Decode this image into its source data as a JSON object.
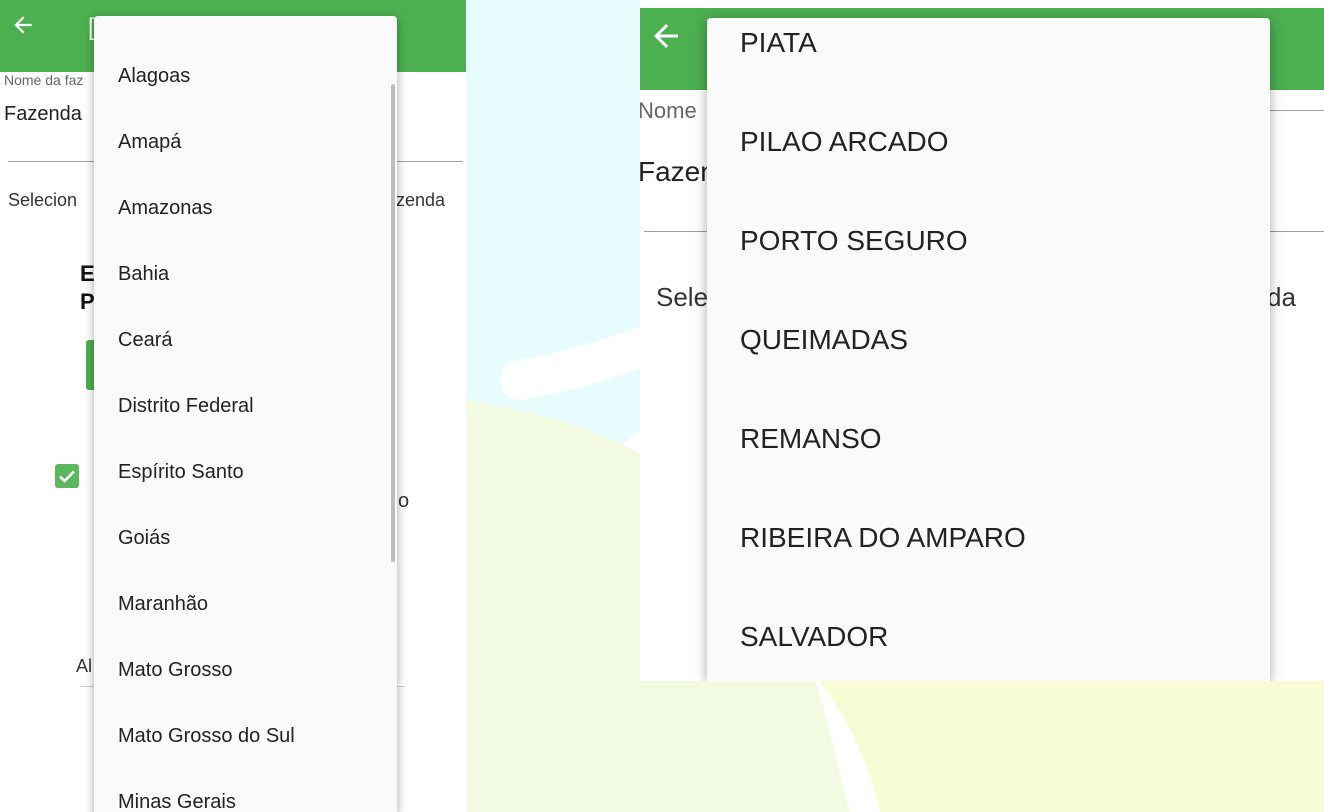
{
  "colors": {
    "appbar": "#4caf50",
    "checkbox": "#5cb85c",
    "menu_background": "#fafafa",
    "background_art": [
      "#e6fcfd",
      "#f2fbe2",
      "#f8fcd5"
    ]
  },
  "left": {
    "appbar": {
      "back_icon": "arrow-left-icon",
      "title_partial": "["
    },
    "field": {
      "label": "Nome da faz",
      "value": "Fazenda"
    },
    "select_text": {
      "left": "Selecion",
      "right": "azenda"
    },
    "heading_partial": {
      "line1": "E",
      "line2": "P"
    },
    "check_text_tail": "o",
    "lower_partial_text": "Al",
    "state_menu": {
      "items": [
        "Alagoas",
        "Amapá",
        "Amazonas",
        "Bahia",
        "Ceará",
        "Distrito Federal",
        "Espírito Santo",
        "Goiás",
        "Maranhão",
        "Mato Grosso",
        "Mato Grosso do Sul",
        "Minas Gerais"
      ]
    }
  },
  "right": {
    "appbar": {
      "back_icon": "arrow-left-icon"
    },
    "field": {
      "label": "Nome",
      "value": "Fazen"
    },
    "select_text": {
      "left": "Sele",
      "right": "da"
    },
    "city_menu": {
      "items": [
        "PIATA",
        "PILAO ARCADO",
        "PORTO SEGURO",
        "QUEIMADAS",
        "REMANSO",
        "RIBEIRA DO AMPARO",
        "SALVADOR"
      ]
    }
  }
}
